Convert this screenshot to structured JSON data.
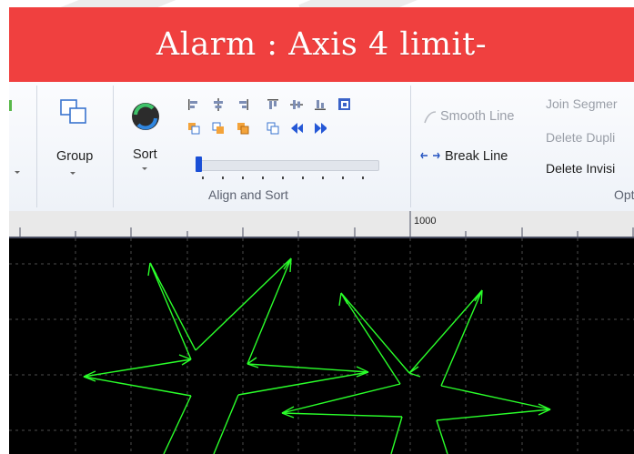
{
  "alarm": {
    "message": "Alarm : Axis 4 limit-"
  },
  "ribbon": {
    "group_label": "Group",
    "sort_label": "Sort",
    "align_sort_label": "Align and Sort",
    "smooth_line_label": "Smooth Line",
    "break_line_label": "Break Line",
    "join_segments_label": "Join Segmer",
    "delete_duplicates_label": "Delete Dupli",
    "delete_invisible_label": "Delete Invisi",
    "optimize_label": "Opt"
  },
  "ruler": {
    "label": "1000"
  },
  "colors": {
    "alarm": "#f0403f",
    "canvas": "#000000",
    "shape": "#2aff2a",
    "grid": "#4c4c4c"
  }
}
